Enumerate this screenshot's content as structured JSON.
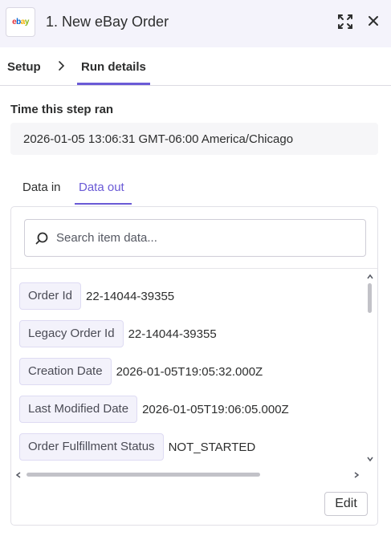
{
  "header": {
    "logo_text": "ebay",
    "title": "1. New eBay Order",
    "expand_icon": "expand-icon",
    "close_icon": "close-icon"
  },
  "nav": {
    "setup_label": "Setup",
    "run_details_label": "Run details",
    "active": "Run details"
  },
  "time": {
    "label": "Time this step ran",
    "value": "2026-01-05 13:06:31 GMT-06:00 America/Chicago"
  },
  "tabs": {
    "data_in_label": "Data in",
    "data_out_label": "Data out",
    "active": "Data out"
  },
  "search": {
    "placeholder": "Search item data...",
    "value": ""
  },
  "items": [
    {
      "key": "Order Id",
      "value": "22-14044-39355"
    },
    {
      "key": "Legacy Order Id",
      "value": "22-14044-39355"
    },
    {
      "key": "Creation Date",
      "value": "2026-01-05T19:05:32.000Z"
    },
    {
      "key": "Last Modified Date",
      "value": "2026-01-05T19:06:05.000Z"
    },
    {
      "key": "Order Fulfillment Status",
      "value": "NOT_STARTED"
    }
  ],
  "footer": {
    "edit_label": "Edit"
  },
  "colors": {
    "accent": "#6a5ad6",
    "header_bg": "#f4f3fb",
    "chip_bg": "#f3f2fb"
  }
}
